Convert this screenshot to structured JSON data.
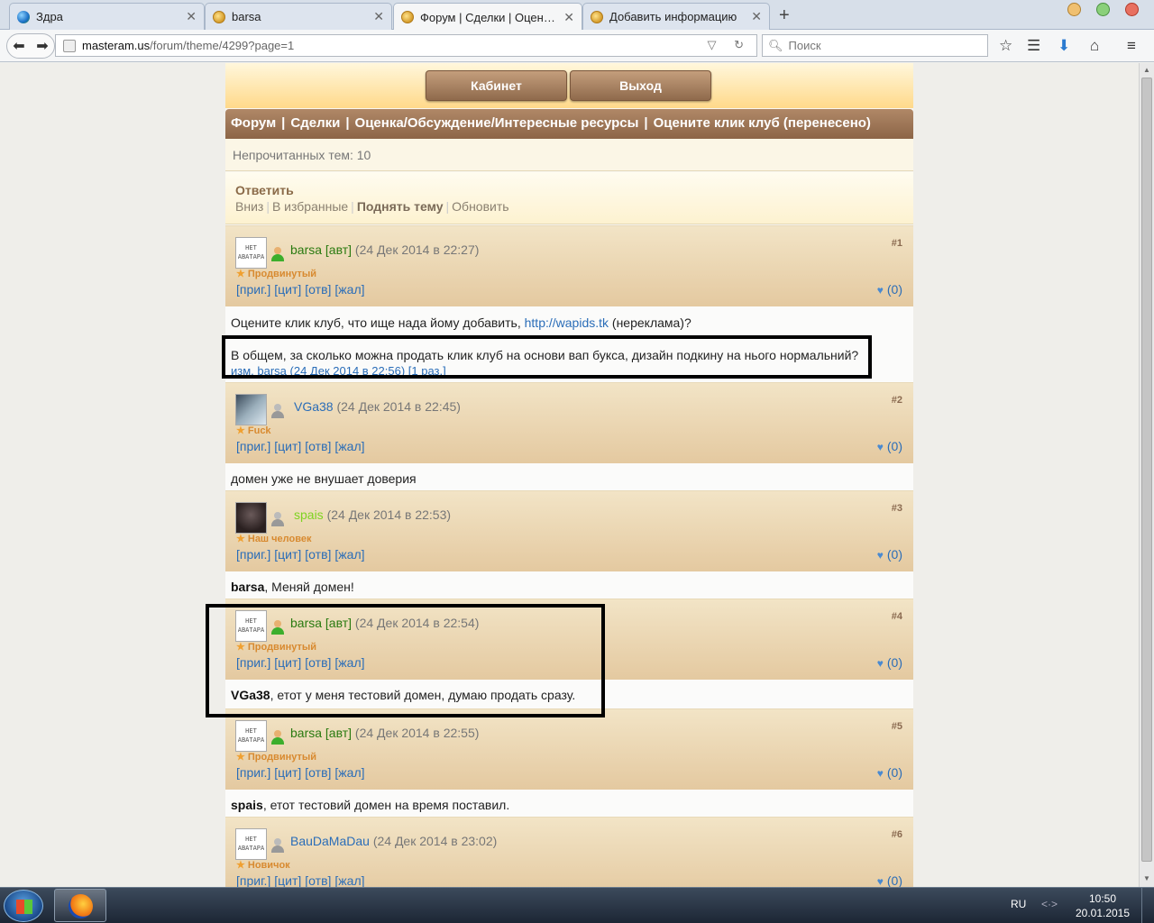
{
  "browser": {
    "tabs": [
      {
        "label": "Здра",
        "icon": "globe-icon",
        "active": false
      },
      {
        "label": "barsa",
        "icon": "coin-icon",
        "active": false
      },
      {
        "label": "Форум | Сделки | Оцен…",
        "icon": "coin-icon",
        "active": true
      },
      {
        "label": "Добавить информацию",
        "icon": "coin-icon",
        "active": false
      }
    ],
    "url_host": "masteram.us",
    "url_path": "/forum/theme/4299?page=1",
    "search_placeholder": "Поиск"
  },
  "site": {
    "nav_buttons": {
      "cabinet": "Кабинет",
      "logout": "Выход"
    },
    "breadcrumbs": [
      "Форум",
      "Сделки",
      "Оценка/Обсуждение/Интересные ресурсы",
      "Оцените клик клуб (перенесено)"
    ],
    "breadcrumb_sep": "|",
    "unread": "Непрочитанных тем: 10",
    "actions": {
      "reply": "Ответить",
      "down": "Вниз",
      "favorites": "В избранные",
      "raise": "Поднять тему",
      "refresh": "Обновить"
    },
    "post_links": [
      "[приг.]",
      "[цит]",
      "[отв]",
      "[жал]"
    ],
    "author_tag": "[авт]",
    "no_avatar": "НЕТ АВАТАРА"
  },
  "posts": [
    {
      "num": "#1",
      "user": "barsa",
      "author": true,
      "online": true,
      "date": "(24 Дек 2014 в 22:27)",
      "rank": "Продвинутый",
      "likes": "(0)",
      "body_pre": "Оцените клик клуб, что ище нада йому добавить, ",
      "body_link": "http://wapids.tk",
      "body_post": " (нереклама)?",
      "body_second": "В общем, за сколько можна продать клик клуб на основи вап букса, дизайн подкину на нього нормальний?",
      "edit_note": "изм. barsa (24 Дек 2014 в 22:56) [1 раз.]"
    },
    {
      "num": "#2",
      "user": "VGa38",
      "author": false,
      "online": false,
      "date": "(24 Дек 2014 в 22:45)",
      "rank": "Fuck",
      "likes": "(0)",
      "body": "домен уже не внушает доверия"
    },
    {
      "num": "#3",
      "user": "spais",
      "author": false,
      "online": false,
      "date": "(24 Дек 2014 в 22:53)",
      "rank": "Наш человек",
      "likes": "(0)",
      "body_name": "barsa",
      "body": ", Меняй домен!"
    },
    {
      "num": "#4",
      "user": "barsa",
      "author": true,
      "online": true,
      "date": "(24 Дек 2014 в 22:54)",
      "rank": "Продвинутый",
      "likes": "(0)",
      "body_name": "VGa38",
      "body": ", етот у меня тестовий домен, думаю продать сразу."
    },
    {
      "num": "#5",
      "user": "barsa",
      "author": true,
      "online": true,
      "date": "(24 Дек 2014 в 22:55)",
      "rank": "Продвинутый",
      "likes": "(0)",
      "body_name": "spais",
      "body": ", етот тестовий домен на время поставил."
    },
    {
      "num": "#6",
      "user": "BauDaMaDau",
      "author": false,
      "online": false,
      "date": "(24 Дек 2014 в 23:02)",
      "rank": "Новичок",
      "likes": "(0)"
    }
  ],
  "taskbar": {
    "lang": "RU",
    "time": "10:50",
    "date": "20.01.2015"
  },
  "colors": {
    "nav_brown": "#8c6547",
    "link_blue": "#2a6db8",
    "author_green": "#2a7a10",
    "rank_orange": "#d88a30",
    "highlight_border": "#000000"
  }
}
